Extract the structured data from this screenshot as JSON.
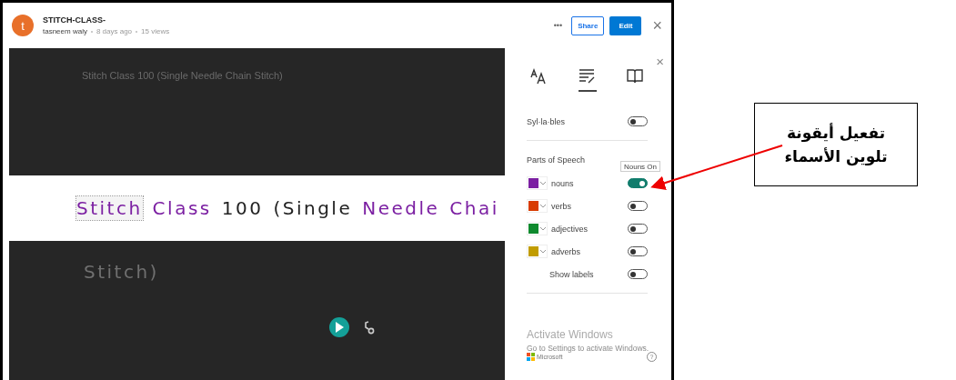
{
  "header": {
    "avatar_letter": "t",
    "title": "STITCH-CLASS-",
    "author": "tasneem waly",
    "age": "8 days ago",
    "views": "15 views",
    "more": "•••",
    "share": "Share",
    "edit": "Edit",
    "close": "×"
  },
  "reader": {
    "caption": "Stitch Class 100 (Single Needle Chain Stitch)",
    "line": [
      {
        "text": "Stitch",
        "kind": "noun",
        "focused": true
      },
      {
        "text": "Class",
        "kind": "noun",
        "focused": false
      },
      {
        "text": "100",
        "kind": "plain",
        "focused": false
      },
      {
        "text": "(Single",
        "kind": "plain",
        "focused": false
      },
      {
        "text": "Needle",
        "kind": "noun",
        "focused": false
      },
      {
        "text": "Chai",
        "kind": "noun",
        "focused": false
      }
    ],
    "next_line": "Stitch)"
  },
  "panel": {
    "close": "×",
    "tabs": [
      {
        "kind": "text-size",
        "selected": false
      },
      {
        "kind": "grammar",
        "selected": true
      },
      {
        "kind": "book",
        "selected": false
      }
    ],
    "syllables": {
      "label": "Syl·la·bles",
      "on": false
    },
    "parts_heading": "Parts of Speech",
    "tooltip": "Nouns On",
    "parts": [
      {
        "label": "nouns",
        "color": "#7b1fa2",
        "on": true
      },
      {
        "label": "verbs",
        "color": "#d83b01",
        "on": false
      },
      {
        "label": "adjectives",
        "color": "#0f8a2e",
        "on": false
      },
      {
        "label": "adverbs",
        "color": "#c19c00",
        "on": false
      }
    ],
    "show_labels": {
      "label": "Show labels",
      "on": false
    },
    "activation": {
      "title": "Activate Windows",
      "text": "Go to Settings to activate Windows.",
      "brand": "Microsoft"
    },
    "help": "?"
  },
  "callout": {
    "lines": [
      "تفعيل أيقونة",
      "تلوين الأسماء"
    ]
  }
}
